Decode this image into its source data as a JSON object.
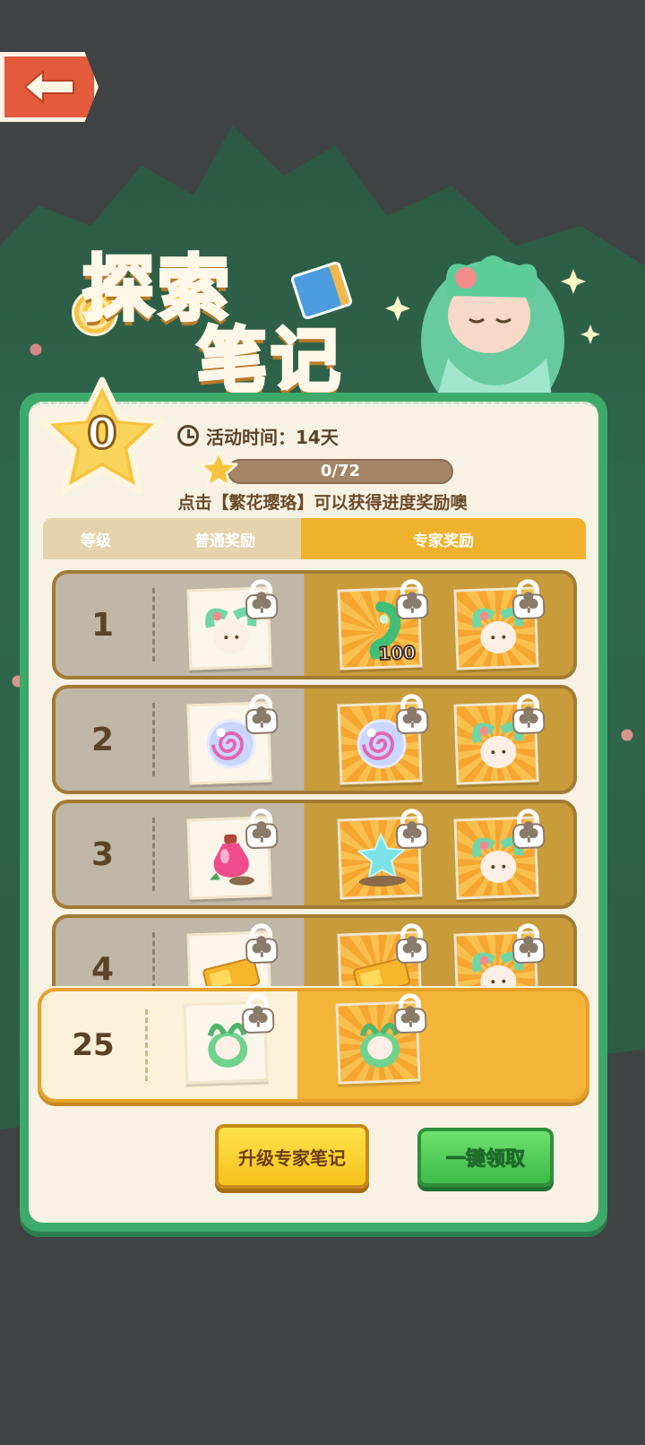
{
  "header": {
    "back_icon": "back-arrow-icon",
    "title_line1": "探索",
    "title_line2": "笔记"
  },
  "summary": {
    "star_level": "0",
    "time_label": "活动时间：14天",
    "progress_text": "0/72",
    "progress_fraction": 0,
    "hint": "点击【繁花璎珞】可以获得进度奖励噢"
  },
  "table": {
    "col_level": "等级",
    "col_normal": "普通奖励",
    "col_expert": "专家奖励"
  },
  "rows": [
    {
      "level": "1",
      "normal": {
        "icon": "bunny-avatar-icon"
      },
      "expert": [
        {
          "icon": "green-gem-icon",
          "qty": "100"
        },
        {
          "icon": "bunny-avatar-icon",
          "qty": ""
        }
      ]
    },
    {
      "level": "2",
      "normal": {
        "icon": "spiral-orb-icon"
      },
      "expert": [
        {
          "icon": "spiral-orb-icon",
          "qty": ""
        },
        {
          "icon": "bunny-avatar-icon",
          "qty": ""
        }
      ]
    },
    {
      "level": "3",
      "normal": {
        "icon": "potion-bottle-icon"
      },
      "expert": [
        {
          "icon": "star-stone-icon",
          "qty": ""
        },
        {
          "icon": "bunny-avatar-icon",
          "qty": ""
        }
      ]
    },
    {
      "level": "4",
      "normal": {
        "icon": "ticket-icon"
      },
      "expert": [
        {
          "icon": "ticket-icon",
          "qty": ""
        },
        {
          "icon": "bunny-avatar-icon",
          "qty": ""
        }
      ]
    }
  ],
  "final_row": {
    "level": "25",
    "normal": {
      "icon": "leaf-bunny-icon"
    },
    "expert": {
      "icon": "leaf-bunny-icon"
    }
  },
  "buttons": {
    "upgrade": "升级专家笔记",
    "claim_all": "一键领取"
  },
  "colors": {
    "panel_green": "#3daa6a",
    "expert_gold": "#f0b12e",
    "upgrade_yellow": "#f6c21c",
    "claim_green": "#3dbb4a"
  }
}
